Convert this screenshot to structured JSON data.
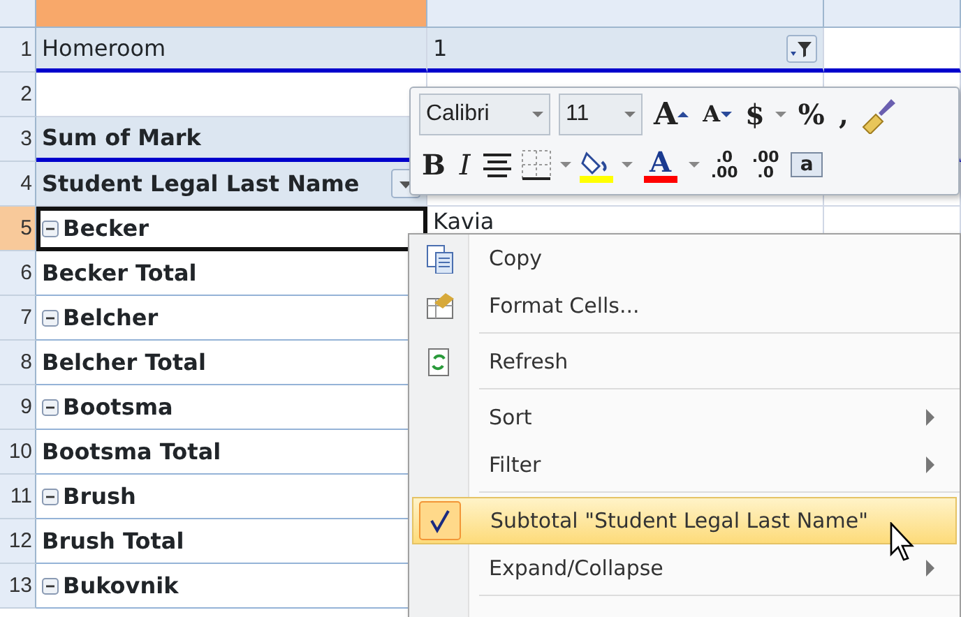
{
  "columns": [
    {
      "selected": false
    },
    {
      "selected": true
    },
    {
      "selected": false
    },
    {
      "selected": false
    }
  ],
  "rows": [
    {
      "number": "1",
      "selected": false,
      "kind": "page_field",
      "label": "Homeroom",
      "value": "1"
    },
    {
      "number": "2",
      "selected": false,
      "kind": "blank"
    },
    {
      "number": "3",
      "selected": false,
      "kind": "data_header",
      "label": "Sum of Mark"
    },
    {
      "number": "4",
      "selected": false,
      "kind": "row_header",
      "label": "Student Legal Last Name"
    },
    {
      "number": "5",
      "selected": true,
      "kind": "item",
      "label": "Becker",
      "expanded": true,
      "value": "Kavia"
    },
    {
      "number": "6",
      "selected": false,
      "kind": "total",
      "label": "Becker Total"
    },
    {
      "number": "7",
      "selected": false,
      "kind": "item",
      "label": "Belcher",
      "expanded": true
    },
    {
      "number": "8",
      "selected": false,
      "kind": "total",
      "label": "Belcher Total"
    },
    {
      "number": "9",
      "selected": false,
      "kind": "item",
      "label": "Bootsma",
      "expanded": true
    },
    {
      "number": "10",
      "selected": false,
      "kind": "total",
      "label": "Bootsma Total"
    },
    {
      "number": "11",
      "selected": false,
      "kind": "item",
      "label": "Brush",
      "expanded": true
    },
    {
      "number": "12",
      "selected": false,
      "kind": "total",
      "label": "Brush Total"
    },
    {
      "number": "13",
      "selected": false,
      "kind": "item",
      "label": "Bukovnik",
      "expanded": true
    }
  ],
  "mini_toolbar": {
    "font": "Calibri",
    "size": "11",
    "row1": [
      {
        "kind": "grow",
        "text": "A"
      },
      {
        "kind": "shrink",
        "text": "A"
      },
      {
        "kind": "glyph",
        "text": "$"
      },
      {
        "kind": "dropdown"
      },
      {
        "kind": "glyph",
        "text": "%"
      },
      {
        "kind": "glyph",
        "text": ","
      },
      {
        "kind": "painter"
      }
    ],
    "row2": [
      {
        "kind": "bold",
        "text": "B"
      },
      {
        "kind": "italic",
        "text": "I"
      },
      {
        "kind": "align"
      },
      {
        "kind": "borders"
      },
      {
        "kind": "dropdown"
      },
      {
        "kind": "fill",
        "color": "#ffff00"
      },
      {
        "kind": "dropdown"
      },
      {
        "kind": "fontcolor",
        "text": "A",
        "color": "#ff0000"
      },
      {
        "kind": "dropdown"
      },
      {
        "kind": "decimal",
        "lines": [
          ".0",
          ".00"
        ]
      },
      {
        "kind": "decimal",
        "lines": [
          ".00",
          ".0"
        ]
      },
      {
        "kind": "merge",
        "text": "a"
      }
    ]
  },
  "context_menu": [
    {
      "kind": "copy",
      "label": "Copy",
      "submenu": false,
      "checked": false,
      "selected": false
    },
    {
      "kind": "format",
      "label": "Format Cells...",
      "submenu": false,
      "checked": false,
      "selected": false
    },
    {
      "kind": "separator"
    },
    {
      "kind": "refresh",
      "label": "Refresh",
      "submenu": false,
      "checked": false,
      "selected": false
    },
    {
      "kind": "separator"
    },
    {
      "kind": "plain",
      "label": "Sort",
      "submenu": true,
      "checked": false,
      "selected": false
    },
    {
      "kind": "plain",
      "label": "Filter",
      "submenu": true,
      "checked": false,
      "selected": false
    },
    {
      "kind": "separator"
    },
    {
      "kind": "plain",
      "label": "Subtotal \"Student Legal Last Name\"",
      "submenu": false,
      "checked": true,
      "selected": true
    },
    {
      "kind": "plain",
      "label": "Expand/Collapse",
      "submenu": true,
      "checked": false,
      "selected": false
    },
    {
      "kind": "separator"
    }
  ]
}
